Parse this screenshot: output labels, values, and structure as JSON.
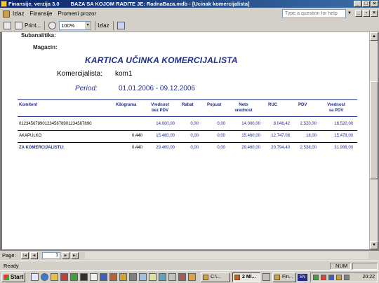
{
  "window": {
    "title": "Finansije, verzija 3.0",
    "db_label": "BAZA SA KOJOM RADITE JE: RadnaBaza.mdb - [Ucinak komercijalista]"
  },
  "menu": {
    "items": [
      "Izlaz",
      "Finansije",
      "Promeni prozor"
    ],
    "help_placeholder": "Type a question for help"
  },
  "toolbar": {
    "print_label": "Print...",
    "zoom_value": "100%",
    "close_label": "Izlaz"
  },
  "report": {
    "subanalitika_label": "Subanalitika:",
    "magacin_label": "Magacin:",
    "title": "KARTICA UČINKA KOMERCIJALISTA",
    "komercijalista_label": "Komercijalista:",
    "komercijalista_value": "kom1",
    "period_label": "Period:",
    "period_value": "01.01.2006 - 09.12.2006",
    "columns": {
      "komitent": "Komitent",
      "kilograma": "Kilograma",
      "vrednost_bez_pdv_1": "Vrednost",
      "vrednost_bez_pdv_2": "bez PDV",
      "rabat": "Rabat",
      "popust": "Popust",
      "neto_1": "Neto",
      "neto_2": "vrednost",
      "ruc": "RUC",
      "pdv": "PDV",
      "vrednost_sa_pdv_1": "Vrednost",
      "vrednost_sa_pdv_2": "sa PDV"
    },
    "rows": [
      {
        "komitent": "0123456789012345678901234567890",
        "kilograma": "",
        "vrednost_bez_pdv": "14.000,00",
        "rabat": "0,00",
        "popust": "0,00",
        "neto": "14.000,00",
        "ruc": "8.046,42",
        "pdv": "2.520,00",
        "vrednost_sa_pdv": "16.520,00"
      },
      {
        "komitent": "AKAPULKO",
        "kilograma": "0,440",
        "vrednost_bez_pdv": "15.460,00",
        "rabat": "0,00",
        "popust": "0,00",
        "neto": "15.460,00",
        "ruc": "12.747,08",
        "pdv": "18,00",
        "vrednost_sa_pdv": "15.478,00"
      }
    ],
    "total": {
      "label": "ZA KOMERCIJALISTU:",
      "kilograma": "0,440",
      "vrednost_bez_pdv": "29.460,00",
      "rabat": "0,00",
      "popust": "0,00",
      "neto": "29.460,00",
      "ruc": "20.794,40",
      "pdv": "2.538,00",
      "vrednost_sa_pdv": "31.998,00"
    }
  },
  "pagenav": {
    "label": "Page:",
    "current_page": "1"
  },
  "status": {
    "ready": "Ready",
    "num": "NUM"
  },
  "taskbar": {
    "start_label": "Start",
    "tasks": [
      "C:\\...",
      "2 Mi...",
      "Fin..."
    ],
    "lang": "EN",
    "clock": "20:22"
  },
  "colors": {
    "report_accent": "#1f2e8c",
    "titlebar_start": "#0a246a",
    "titlebar_end": "#3a6ea5",
    "chrome": "#d4d0c8"
  }
}
